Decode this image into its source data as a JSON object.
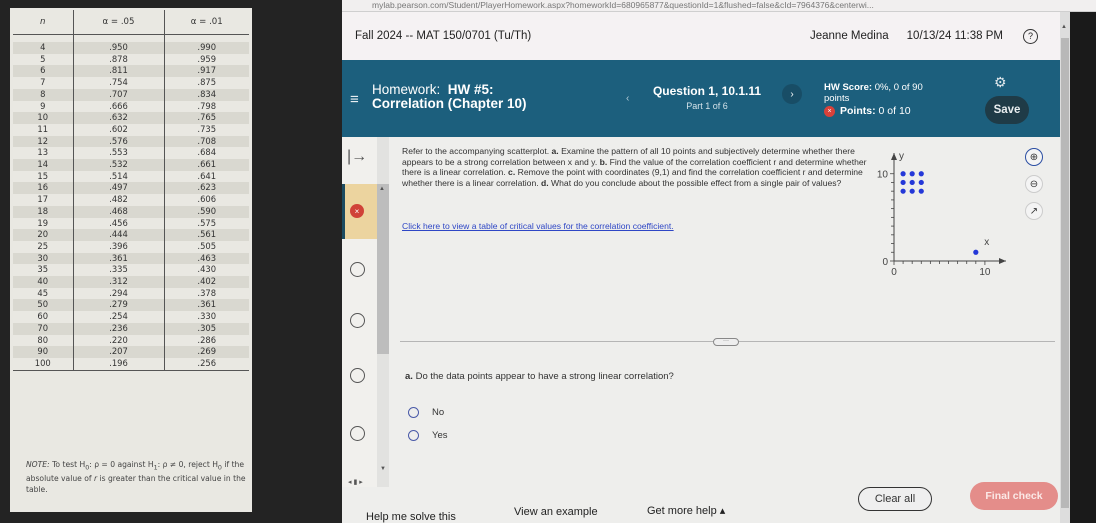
{
  "critical_table": {
    "headers": [
      "n",
      "α = .05",
      "α = .01"
    ],
    "rows": [
      [
        "4",
        ".950",
        ".990"
      ],
      [
        "5",
        ".878",
        ".959"
      ],
      [
        "6",
        ".811",
        ".917"
      ],
      [
        "7",
        ".754",
        ".875"
      ],
      [
        "8",
        ".707",
        ".834"
      ],
      [
        "9",
        ".666",
        ".798"
      ],
      [
        "10",
        ".632",
        ".765"
      ],
      [
        "11",
        ".602",
        ".735"
      ],
      [
        "12",
        ".576",
        ".708"
      ],
      [
        "13",
        ".553",
        ".684"
      ],
      [
        "14",
        ".532",
        ".661"
      ],
      [
        "15",
        ".514",
        ".641"
      ],
      [
        "16",
        ".497",
        ".623"
      ],
      [
        "17",
        ".482",
        ".606"
      ],
      [
        "18",
        ".468",
        ".590"
      ],
      [
        "19",
        ".456",
        ".575"
      ],
      [
        "20",
        ".444",
        ".561"
      ],
      [
        "25",
        ".396",
        ".505"
      ],
      [
        "30",
        ".361",
        ".463"
      ],
      [
        "35",
        ".335",
        ".430"
      ],
      [
        "40",
        ".312",
        ".402"
      ],
      [
        "45",
        ".294",
        ".378"
      ],
      [
        "50",
        ".279",
        ".361"
      ],
      [
        "60",
        ".254",
        ".330"
      ],
      [
        "70",
        ".236",
        ".305"
      ],
      [
        "80",
        ".220",
        ".286"
      ],
      [
        "90",
        ".207",
        ".269"
      ],
      [
        "100",
        ".196",
        ".256"
      ]
    ],
    "note_prefix": "NOTE:",
    "note_text_1": " To test H",
    "note_text_2": ": ρ = 0 against H",
    "note_text_3": ": ρ ≠ 0, reject H",
    "note_text_4": " if the absolute value of ",
    "note_r": "r",
    "note_text_5": " is greater than the critical value in the table.",
    "sub_0": "0",
    "sub_1": "1"
  },
  "browser": {
    "url": "mylab.pearson.com/Student/PlayerHomework.aspx?homeworkId=680965877&questionId=1&flushed=false&cId=7964376&centerwi..."
  },
  "course_header": {
    "title": "Fall 2024 -- MAT 150/0701 (Tu/Th)",
    "user": "Jeanne Medina",
    "datetime": "10/13/24 11:38 PM",
    "help_glyph": "?"
  },
  "banner": {
    "menu_glyph": "≡",
    "hw_label": "Homework:",
    "hw_name_line1": "HW #5:",
    "hw_name_line2": "Correlation (Chapter 10)",
    "prev_glyph": "‹",
    "question_title": "Question 1, 10.1.11",
    "question_part": "Part 1 of 6",
    "next_glyph": "›",
    "hw_score_label": "HW Score:",
    "hw_score_value": "0%, 0 of 90",
    "hw_score_suffix": "points",
    "points_label": "Points:",
    "points_value": "0 of 10",
    "gear_glyph": "⚙",
    "save_label": "Save",
    "colors": {
      "banner": "#1c5f7d",
      "save": "#1f3b47",
      "error": "#d9413a"
    }
  },
  "nav": {
    "collapse_glyph": "|→",
    "x_glyph": "×",
    "up_glyph": "▲",
    "down_glyph": "▼",
    "hscroll_glyph": "◂ ▮ ▸"
  },
  "question": {
    "intro": "Refer to the accompanying scatterplot. ",
    "a_label": "a.",
    "a_text": " Examine the pattern of all 10 points and subjectively determine whether there appears to be a strong correlation between x and y. ",
    "b_label": "b.",
    "b_text": " Find the value of the correlation coefficient r and determine whether there is a linear correlation. ",
    "c_label": "c.",
    "c_text": " Remove the point with coordinates (9,1) and find the correlation coefficient r and determine whether there is a linear correlation. ",
    "d_label": "d.",
    "d_text": " What do you conclude about the possible effect from a single pair of values?",
    "critical_link": "Click here to view a table of critical values for the correlation coefficient.",
    "more_glyph": "···",
    "prompt_label": "a.",
    "prompt_text": " Do the data points appear to have a strong linear correlation?",
    "options": [
      "No",
      "Yes"
    ]
  },
  "chart_data": {
    "type": "scatter",
    "title": "",
    "xlabel": "x",
    "ylabel": "y",
    "xlim": [
      0,
      11
    ],
    "ylim": [
      0,
      11
    ],
    "x_ticks_labeled": [
      "0",
      "10"
    ],
    "y_ticks_labeled": [
      "0",
      "10"
    ],
    "points": [
      [
        1,
        8
      ],
      [
        2,
        8
      ],
      [
        3,
        8
      ],
      [
        1,
        9
      ],
      [
        2,
        9
      ],
      [
        3,
        9
      ],
      [
        1,
        10
      ],
      [
        2,
        10
      ],
      [
        3,
        10
      ],
      [
        9,
        1
      ]
    ],
    "point_color": "#2438d8",
    "grid": false
  },
  "tools": {
    "zoom_in_glyph": "⊕",
    "zoom_out_glyph": "⊖",
    "popout_glyph": "↗"
  },
  "footer": {
    "help_solve": "Help me solve this",
    "view_example": "View an example",
    "get_more_help": "Get more help ▴",
    "clear_all": "Clear all",
    "final_check": "Final check"
  }
}
